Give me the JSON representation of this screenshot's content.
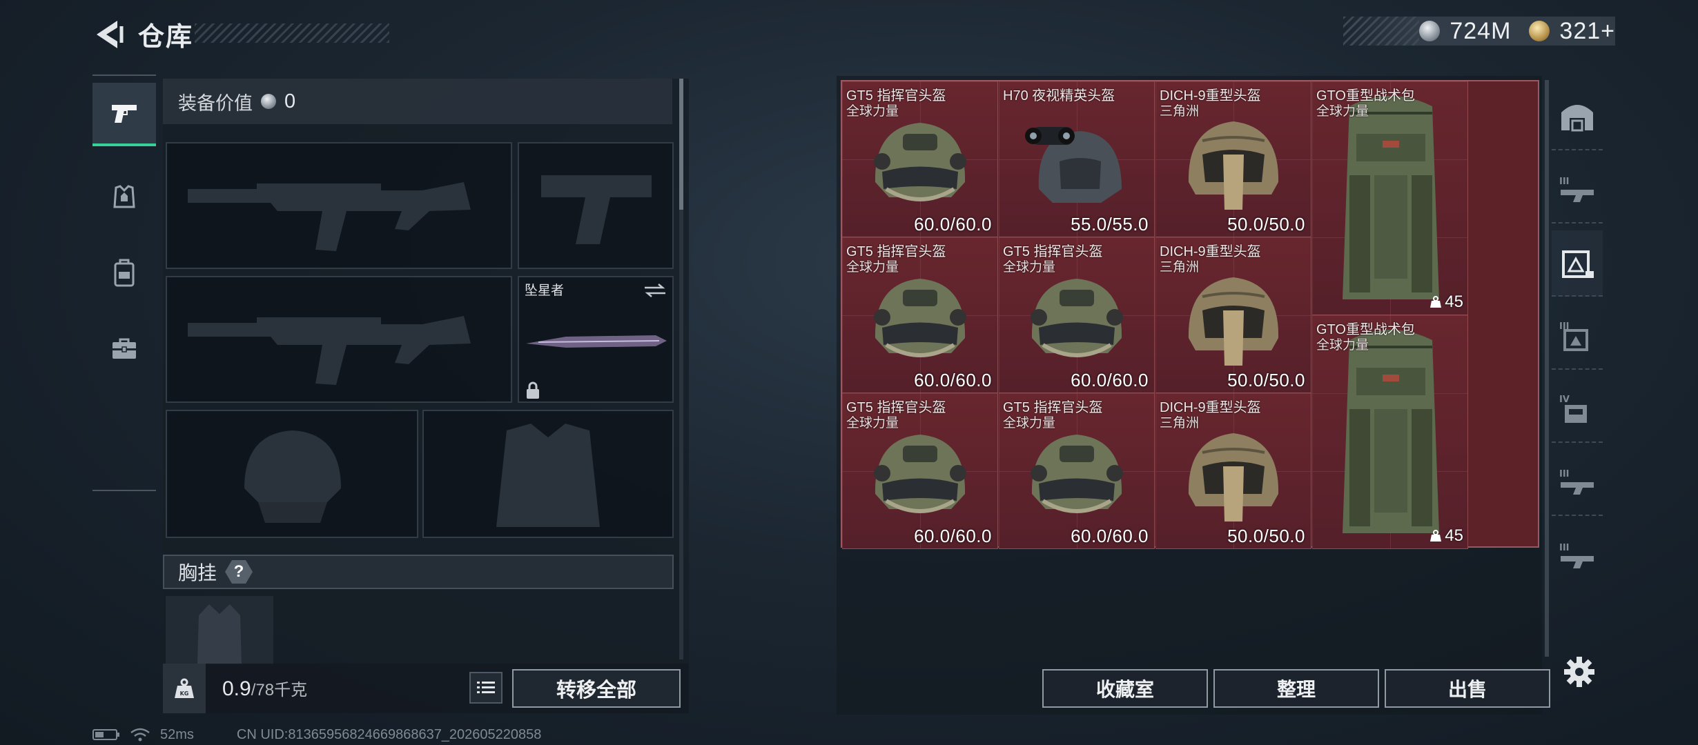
{
  "header": {
    "title": "仓库",
    "currency": [
      {
        "icon": "silver-coin-icon",
        "value": "724M"
      },
      {
        "icon": "gold-coin-icon",
        "value": "321+"
      }
    ]
  },
  "left_nav": {
    "items": [
      {
        "icon": "pistol-icon",
        "active": true
      },
      {
        "icon": "armor-vest-icon",
        "active": false
      },
      {
        "icon": "backpack-icon",
        "active": false
      },
      {
        "icon": "toolbox-icon",
        "active": false
      }
    ]
  },
  "equipment": {
    "value_label": "装备价值",
    "value_amount": "0",
    "melee_slot_name": "坠星者",
    "chest_rig_label": "胸挂",
    "chest_rig_help": "?"
  },
  "inventory_footer": {
    "weight_current": "0.9",
    "weight_max": "/78千克",
    "transfer_all_label": "转移全部"
  },
  "stash_items": [
    {
      "name": "GT5 指挥官头盔",
      "sub": "全球力量",
      "durability": "60.0/60.0",
      "type": "helmet-gt5"
    },
    {
      "name": "H70 夜视精英头盔",
      "sub": "",
      "durability": "55.0/55.0",
      "type": "helmet-h70"
    },
    {
      "name": "DICH-9重型头盔",
      "sub": "三角洲",
      "durability": "50.0/50.0",
      "type": "helmet-dich"
    },
    {
      "name": "GTO重型战术包",
      "sub": "全球力量",
      "capacity": "45",
      "type": "backpack"
    },
    {
      "name": "GT5 指挥官头盔",
      "sub": "全球力量",
      "durability": "60.0/60.0",
      "type": "helmet-gt5"
    },
    {
      "name": "GT5 指挥官头盔",
      "sub": "全球力量",
      "durability": "60.0/60.0",
      "type": "helmet-gt5"
    },
    {
      "name": "DICH-9重型头盔",
      "sub": "三角洲",
      "durability": "50.0/50.0",
      "type": "helmet-dich"
    },
    {
      "name": "GTO重型战术包",
      "sub": "全球力量",
      "capacity": "45",
      "type": "backpack"
    },
    {
      "name": "GT5 指挥官头盔",
      "sub": "全球力量",
      "durability": "60.0/60.0",
      "type": "helmet-gt5"
    },
    {
      "name": "GT5 指挥官头盔",
      "sub": "全球力量",
      "durability": "60.0/60.0",
      "type": "helmet-gt5"
    },
    {
      "name": "DICH-9重型头盔",
      "sub": "三角洲",
      "durability": "50.0/50.0",
      "type": "helmet-dich"
    }
  ],
  "right_nav": {
    "items": [
      {
        "icon": "home-vault-icon",
        "active": false
      },
      {
        "icon": "stash-tab-3-icon",
        "active": false
      },
      {
        "icon": "stash-tab-active-icon",
        "active": true
      },
      {
        "icon": "stash-tab-3b-icon",
        "active": false
      },
      {
        "icon": "stash-tab-4-icon",
        "active": false
      },
      {
        "icon": "stash-tab-3c-icon",
        "active": false
      },
      {
        "icon": "stash-tab-3d-icon",
        "active": false
      }
    ]
  },
  "actions": {
    "collection_label": "收藏室",
    "organize_label": "整理",
    "sell_label": "出售"
  },
  "status": {
    "ping": "52ms",
    "uid": "CN UID:81365956824669868637_202605220858"
  }
}
